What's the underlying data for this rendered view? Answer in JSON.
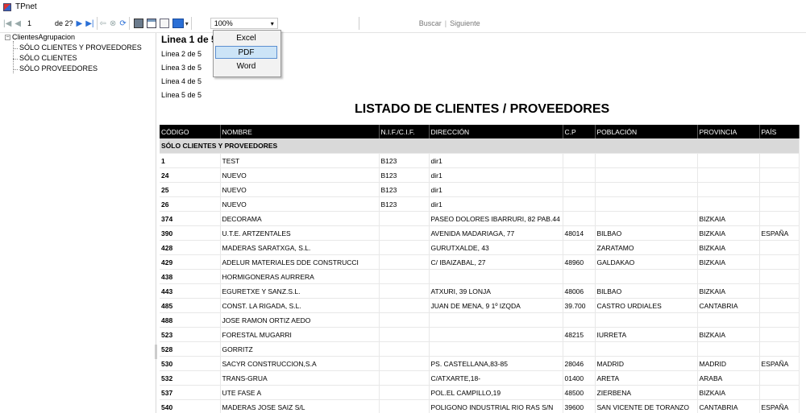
{
  "window": {
    "title": "TPnet"
  },
  "toolbar": {
    "page_current": "1",
    "page_of": "de 2?",
    "zoom": "100%",
    "find_label": "Buscar",
    "find_separator": "|",
    "next_label": "Siguiente"
  },
  "export_menu": {
    "items": [
      "Excel",
      "PDF",
      "Word"
    ]
  },
  "tree": {
    "root": "ClientesAgrupacion",
    "expander": "−",
    "children": [
      "SÓLO CLIENTES Y PROVEEDORES",
      "SÓLO CLIENTES",
      "SÓLO PROVEEDORES"
    ]
  },
  "docmap": {
    "first": "Linea 1 de 5",
    "items": [
      "Línea 2 de 5",
      "Línea 3 de 5",
      "Línea 4 de 5",
      "Línea 5 de 5"
    ]
  },
  "report": {
    "title": "LISTADO DE CLIENTES / PROVEEDORES",
    "columns": [
      "CÓDIGO",
      "NOMBRE",
      "N.I.F./C.I.F.",
      "DIRECCIÓN",
      "C.P",
      "POBLACIÓN",
      "PROVINCIA",
      "PAÍS"
    ],
    "group": "SÓLO CLIENTES Y PROVEEDORES",
    "rows": [
      [
        "1",
        "TEST",
        "B123",
        "dir1",
        "",
        "",
        "",
        ""
      ],
      [
        "24",
        "NUEVO",
        "B123",
        "dir1",
        "",
        "",
        "",
        ""
      ],
      [
        "25",
        "NUEVO",
        "B123",
        "dir1",
        "",
        "",
        "",
        ""
      ],
      [
        "26",
        "NUEVO",
        "B123",
        "dir1",
        "",
        "",
        "",
        ""
      ],
      [
        "374",
        "DECORAMA",
        "",
        "PASEO DOLORES IBARRURI, 82   PAB.44",
        "",
        "",
        "BIZKAIA",
        ""
      ],
      [
        "390",
        "U.T.E. ARTZENTALES",
        "",
        "AVENIDA MADARIAGA, 77",
        "48014",
        "BILBAO",
        "BIZKAIA",
        "ESPAÑA"
      ],
      [
        "428",
        "MADERAS SARATXGA, S.L.",
        "",
        "GURUTXALDE, 43",
        "",
        "ZARATAMO",
        "BIZKAIA",
        ""
      ],
      [
        "429",
        "ADELUR MATERIALES DDE CONSTRUCCI",
        "",
        "C/ IBAIZABAL, 27",
        "48960",
        "GALDAKAO",
        "BIZKAIA",
        ""
      ],
      [
        "438",
        "HORMIGONERAS AURRERA",
        "",
        "",
        "",
        "",
        "",
        ""
      ],
      [
        "443",
        "EGURETXE Y SANZ.S.L.",
        "",
        "ATXURI, 39 LONJA",
        "48006",
        "BILBAO",
        "BIZKAIA",
        ""
      ],
      [
        "485",
        "CONST. LA RIGADA, S.L.",
        "",
        "JUAN DE MENA, 9 1º IZQDA",
        "39.700",
        "CASTRO URDIALES",
        "CANTABRIA",
        ""
      ],
      [
        "488",
        "JOSE RAMON ORTIZ AEDO",
        "",
        "",
        "",
        "",
        "",
        ""
      ],
      [
        "523",
        "FORESTAL MUGARRI",
        "",
        "",
        "48215",
        "IURRETA",
        "BIZKAIA",
        ""
      ],
      [
        "528",
        "GORRITZ",
        "",
        "",
        "",
        "",
        "",
        ""
      ],
      [
        "530",
        "SACYR CONSTRUCCION,S.A",
        "",
        "PS. CASTELLANA,83-85",
        "28046",
        "MADRID",
        "MADRID",
        "ESPAÑA"
      ],
      [
        "532",
        "TRANS-GRUA",
        "",
        "C/ATXARTE,18-",
        "01400",
        "ARETA",
        "ARABA",
        ""
      ],
      [
        "537",
        "UTE FASE A",
        "",
        "POL.EL CAMPILLO,19",
        "48500",
        "ZIERBENA",
        "BIZKAIA",
        ""
      ],
      [
        "540",
        "MADERAS JOSE SAIZ S/L",
        "",
        "POLIGONO INDUSTRIAL RIO RAS S/N",
        "39600",
        "SAN VICENTE DE TORANZO",
        "CANTABRIA",
        "ESPAÑA"
      ]
    ]
  }
}
